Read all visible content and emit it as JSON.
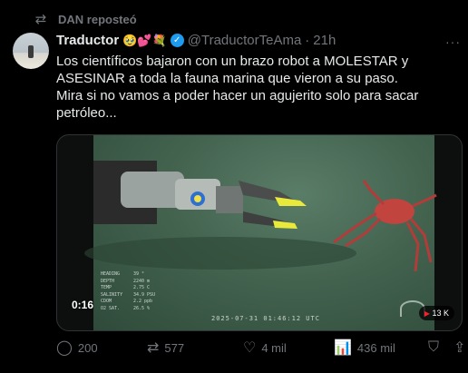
{
  "repost": {
    "icon": "repost-icon",
    "label": "DAN reposteó"
  },
  "author": {
    "display_name": "Traductor",
    "emojis": "🥹💕💐",
    "verified": true,
    "handle": "@TraductorTeAma",
    "time": "21h"
  },
  "tweet": {
    "paragraphs": [
      "Los científicos bajaron con un brazo robot a MOLESTAR y ASESINAR a toda la fauna marina que vieron a su paso.",
      "Mira si no vamos a poder hacer un agujerito solo para sacar petróleo..."
    ]
  },
  "media": {
    "duration": "0:16",
    "views": "13 K",
    "video_timestamp": "2025-07-31  01:46:12 UTC",
    "hud": [
      {
        "label": "HEADING",
        "value": "39 °"
      },
      {
        "label": "DEPTH",
        "value": "2240 m"
      },
      {
        "label": "TEMP",
        "value": "2.75 C"
      },
      {
        "label": "SALINITY",
        "value": "34.9 PSU"
      },
      {
        "label": "CDOM",
        "value": "2.2 ppb"
      },
      {
        "label": "O2 SAT.",
        "value": "26.5 %"
      }
    ]
  },
  "actions": {
    "replies": "200",
    "reposts": "577",
    "likes": "4 mil",
    "views": "436 mil"
  },
  "colors": {
    "background": "#000000",
    "text": "#e7e9ea",
    "muted": "#71767b",
    "accent": "#1d9bf0"
  }
}
